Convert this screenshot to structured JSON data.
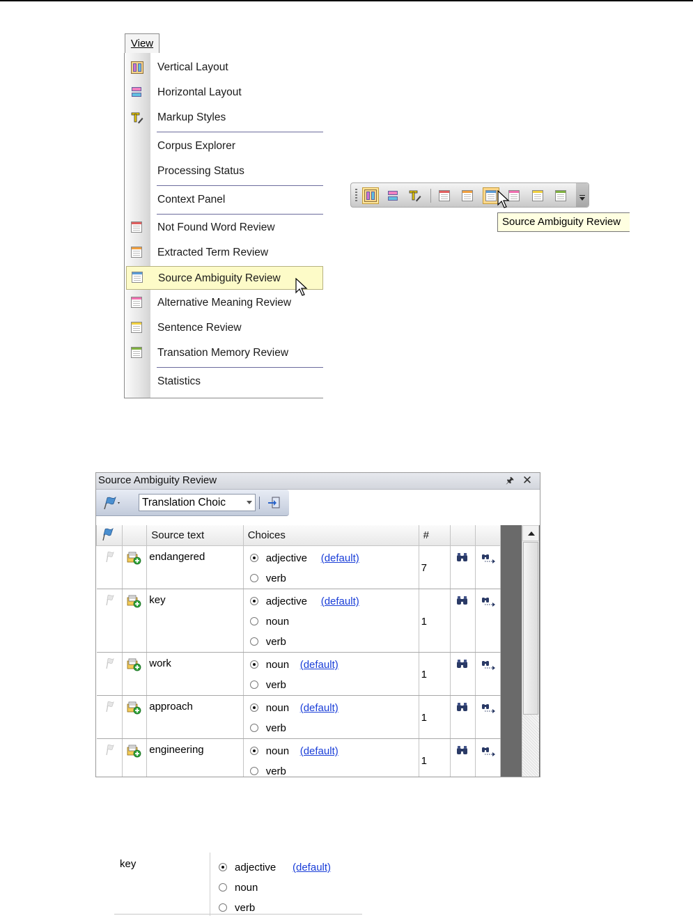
{
  "view_menu": {
    "title": "View",
    "items": [
      {
        "label": "Vertical Layout",
        "icon": "vertical-layout-icon"
      },
      {
        "label": "Horizontal Layout",
        "icon": "horizontal-layout-icon"
      },
      {
        "label": "Markup Styles",
        "icon": "markup-styles-icon"
      },
      {
        "label": "Corpus Explorer",
        "icon": ""
      },
      {
        "label": "Processing Status",
        "icon": ""
      },
      {
        "label": "Context Panel",
        "icon": ""
      },
      {
        "label": "Not Found Word Review",
        "icon": "red-grid-icon"
      },
      {
        "label": "Extracted Term Review",
        "icon": "orange-grid-icon"
      },
      {
        "label": "Source Ambiguity Review",
        "icon": "blue-grid-icon",
        "highlighted": true
      },
      {
        "label": "Alternative Meaning Review",
        "icon": "pink-grid-icon"
      },
      {
        "label": "Sentence Review",
        "icon": "yellow-grid-icon"
      },
      {
        "label": "Transation Memory Review",
        "icon": "green-grid-icon"
      },
      {
        "label": "Statistics",
        "icon": ""
      }
    ]
  },
  "toolbar": {
    "tooltip": "Source Ambiguity Review",
    "buttons": [
      "vertical-layout",
      "horizontal-layout",
      "markup-styles",
      "not-found-word-review",
      "extracted-term-review",
      "source-ambiguity-review",
      "alternative-meaning-review",
      "sentence-review",
      "translation-memory-review"
    ]
  },
  "panel": {
    "title": "Source Ambiguity Review",
    "combo_value": "Translation Choic",
    "columns": [
      "",
      "",
      "Source text",
      "Choices",
      "#",
      "",
      ""
    ],
    "rows": [
      {
        "source": "endangered",
        "count": "7",
        "choices": [
          {
            "label": "adjective",
            "selected": true,
            "default": "(default)"
          },
          {
            "label": "verb",
            "selected": false,
            "default": ""
          }
        ]
      },
      {
        "source": "key",
        "count": "1",
        "choices": [
          {
            "label": "adjective",
            "selected": true,
            "default": "(default)"
          },
          {
            "label": "noun",
            "selected": false,
            "default": ""
          },
          {
            "label": "verb",
            "selected": false,
            "default": ""
          }
        ]
      },
      {
        "source": "work",
        "count": "1",
        "choices": [
          {
            "label": "noun",
            "selected": true,
            "default": "(default)"
          },
          {
            "label": "verb",
            "selected": false,
            "default": ""
          }
        ]
      },
      {
        "source": "approach",
        "count": "1",
        "choices": [
          {
            "label": "noun",
            "selected": true,
            "default": "(default)"
          },
          {
            "label": "verb",
            "selected": false,
            "default": ""
          }
        ]
      },
      {
        "source": "engineering",
        "count": "1",
        "choices": [
          {
            "label": "noun",
            "selected": true,
            "default": "(default)"
          },
          {
            "label": "verb",
            "selected": false,
            "default": ""
          }
        ]
      }
    ]
  },
  "detail": {
    "source": "key",
    "choices": [
      {
        "label": "adjective",
        "selected": true,
        "default": "(default)"
      },
      {
        "label": "noun",
        "selected": false,
        "default": ""
      },
      {
        "label": "verb",
        "selected": false,
        "default": ""
      }
    ]
  }
}
